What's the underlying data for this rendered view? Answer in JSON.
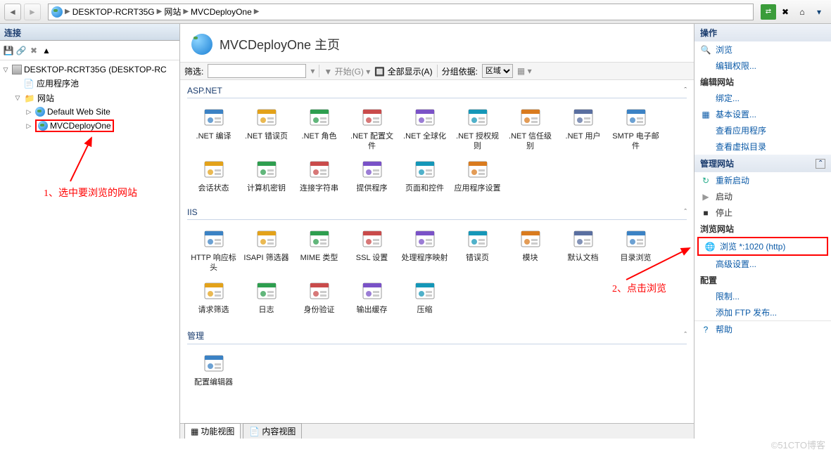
{
  "breadcrumb": {
    "root": "DESKTOP-RCRT35G",
    "l1": "网站",
    "l2": "MVCDeployOne"
  },
  "left": {
    "title": "连接",
    "tree": {
      "root": "DESKTOP-RCRT35G (DESKTOP-RC",
      "pools": "应用程序池",
      "sites": "网站",
      "site1": "Default Web Site",
      "site2": "MVCDeployOne"
    }
  },
  "annotations": {
    "a1": "1、选中要浏览的网站",
    "a2": "2、点击浏览"
  },
  "center": {
    "title": "MVCDeployOne 主页",
    "filter": {
      "label": "筛选:",
      "start": "开始(G)",
      "showall": "全部显示(A)",
      "groupby": "分组依据:",
      "groupval": "区域"
    },
    "sections": {
      "aspnet": {
        "title": "ASP.NET",
        "items": [
          ".NET 编译",
          ".NET 错误页",
          ".NET 角色",
          ".NET 配置文件",
          ".NET 全球化",
          ".NET 授权规则",
          ".NET 信任级别",
          ".NET 用户",
          "SMTP 电子邮件",
          "会话状态",
          "计算机密钥",
          "连接字符串",
          "提供程序",
          "页面和控件",
          "应用程序设置"
        ]
      },
      "iis": {
        "title": "IIS",
        "items": [
          "HTTP 响应标头",
          "ISAPI 筛选器",
          "MIME 类型",
          "SSL 设置",
          "处理程序映射",
          "错误页",
          "模块",
          "默认文档",
          "目录浏览",
          "请求筛选",
          "日志",
          "身份验证",
          "输出缓存",
          "压缩"
        ]
      },
      "mgmt": {
        "title": "管理",
        "items": [
          "配置编辑器"
        ]
      }
    },
    "tabs": {
      "features": "功能视图",
      "content": "内容视图"
    }
  },
  "right": {
    "title": "操作",
    "explore": "浏览",
    "editperms": "编辑权限...",
    "editsite": "编辑网站",
    "bindings": "绑定...",
    "basic": "基本设置...",
    "viewapps": "查看应用程序",
    "viewvdir": "查看虚拟目录",
    "manage": "管理网站",
    "restart": "重新启动",
    "start": "启动",
    "stop": "停止",
    "browsesite": "浏览网站",
    "browselink": "浏览 *:1020 (http)",
    "advanced": "高级设置...",
    "configure": "配置",
    "limits": "限制...",
    "addftp": "添加 FTP 发布...",
    "help": "帮助"
  },
  "watermark": "©51CTO博客"
}
